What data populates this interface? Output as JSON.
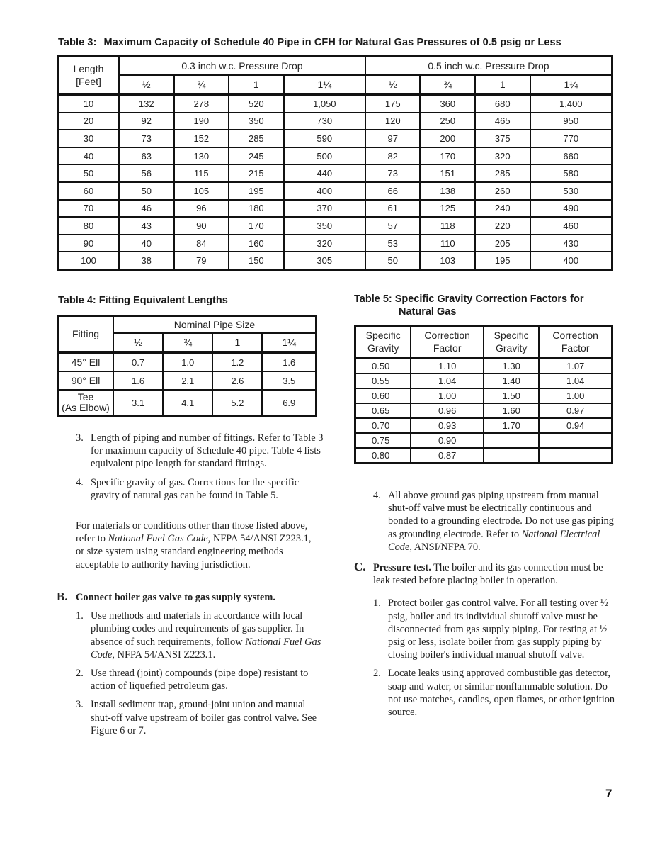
{
  "table3": {
    "label": "Table 3:",
    "title": "Maximum Capacity of Schedule 40 Pipe in CFH for Natural Gas Pressures of 0.5 psig or Less",
    "length_header_line1": "Length",
    "length_header_line2": "[Feet]",
    "group_headers": [
      "0.3 inch w.c. Pressure Drop",
      "0.5 inch w.c. Pressure Drop"
    ],
    "pipe_sizes": [
      "½",
      "¾",
      "1",
      "1¼",
      "½",
      "¾",
      "1",
      "1¼"
    ],
    "rows": [
      [
        "10",
        "132",
        "278",
        "520",
        "1,050",
        "175",
        "360",
        "680",
        "1,400"
      ],
      [
        "20",
        "92",
        "190",
        "350",
        "730",
        "120",
        "250",
        "465",
        "950"
      ],
      [
        "30",
        "73",
        "152",
        "285",
        "590",
        "97",
        "200",
        "375",
        "770"
      ],
      [
        "40",
        "63",
        "130",
        "245",
        "500",
        "82",
        "170",
        "320",
        "660"
      ],
      [
        "50",
        "56",
        "115",
        "215",
        "440",
        "73",
        "151",
        "285",
        "580"
      ],
      [
        "60",
        "50",
        "105",
        "195",
        "400",
        "66",
        "138",
        "260",
        "530"
      ],
      [
        "70",
        "46",
        "96",
        "180",
        "370",
        "61",
        "125",
        "240",
        "490"
      ],
      [
        "80",
        "43",
        "90",
        "170",
        "350",
        "57",
        "118",
        "220",
        "460"
      ],
      [
        "90",
        "40",
        "84",
        "160",
        "320",
        "53",
        "110",
        "205",
        "430"
      ],
      [
        "100",
        "38",
        "79",
        "150",
        "305",
        "50",
        "103",
        "195",
        "400"
      ]
    ]
  },
  "table4": {
    "title": "Table 4: Fitting Equivalent Lengths",
    "fitting_header": "Fitting",
    "group_header": "Nominal Pipe Size",
    "pipe_sizes": [
      "½",
      "¾",
      "1",
      "1¼"
    ],
    "rows": [
      {
        "fitting_line1": "45° Ell",
        "fitting_line2": "",
        "values": [
          "0.7",
          "1.0",
          "1.2",
          "1.6"
        ]
      },
      {
        "fitting_line1": "90° Ell",
        "fitting_line2": "",
        "values": [
          "1.6",
          "2.1",
          "2.6",
          "3.5"
        ]
      },
      {
        "fitting_line1": "Tee",
        "fitting_line2": "(As Elbow)",
        "values": [
          "3.1",
          "4.1",
          "5.2",
          "6.9"
        ]
      }
    ]
  },
  "table5": {
    "title_line1": "Table 5: Specific Gravity Correction Factors for",
    "title_line2": "Natural Gas",
    "headers": [
      {
        "line1": "Specific",
        "line2": "Gravity"
      },
      {
        "line1": "Correction",
        "line2": "Factor"
      },
      {
        "line1": "Specific",
        "line2": "Gravity"
      },
      {
        "line1": "Correction",
        "line2": "Factor"
      }
    ],
    "rows": [
      [
        "0.50",
        "1.10",
        "1.30",
        "1.07"
      ],
      [
        "0.55",
        "1.04",
        "1.40",
        "1.04"
      ],
      [
        "0.60",
        "1.00",
        "1.50",
        "1.00"
      ],
      [
        "0.65",
        "0.96",
        "1.60",
        "0.97"
      ],
      [
        "0.70",
        "0.93",
        "1.70",
        "0.94"
      ],
      [
        "0.75",
        "0.90",
        "",
        ""
      ],
      [
        "0.80",
        "0.87",
        "",
        ""
      ]
    ]
  },
  "left_list": [
    {
      "num": "3.",
      "text": "Length of piping and number of fittings. Refer to Table 3 for maximum capacity of Schedule 40 pipe. Table 4 lists equivalent pipe length for standard fittings."
    },
    {
      "num": "4.",
      "text": "Specific gravity of gas. Corrections for the specific gravity of natural gas can be found in Table 5."
    }
  ],
  "left_para": {
    "before": "For materials or conditions other than those listed above, refer to ",
    "italic": "National Fuel Gas Code",
    "after": ", NFPA 54/ANSI Z223.1, or size system using standard engineering methods acceptable to authority having jurisdiction."
  },
  "section_b": {
    "letter": "B.",
    "heading": "Connect boiler gas valve to gas supply system.",
    "items": [
      {
        "num": "1.",
        "before": "Use methods and materials in accordance with local plumbing codes and requirements of gas supplier. In absence of such requirements, follow ",
        "italic": "National Fuel Gas Code",
        "after": ", NFPA 54/ANSI Z223.1."
      },
      {
        "num": "2.",
        "before": "Use thread (joint) compounds (pipe dope) resistant to action of liquefied petroleum gas.",
        "italic": "",
        "after": ""
      },
      {
        "num": "3.",
        "before": "Install sediment trap, ground-joint union and manual shut-off valve upstream of boiler gas control valve. See Figure 6 or 7.",
        "italic": "",
        "after": ""
      }
    ]
  },
  "right_item4": {
    "num": "4.",
    "before": "All above ground gas piping upstream from manual shut-off valve must be electrically continuous and bonded to a grounding electrode.  Do not use gas piping as grounding electrode.  Refer to ",
    "italic": "National Electrical Code",
    "after": ", ANSI/NFPA 70."
  },
  "section_c": {
    "letter": "C.",
    "heading": "Pressure test.",
    "intro": " The boiler and its gas connection must be leak tested before placing boiler in operation.",
    "items": [
      {
        "num": "1.",
        "text": "Protect boiler gas control valve. For all testing over ½ psig, boiler and its individual shutoff valve must be disconnected from gas supply piping. For testing at ½ psig or less, isolate boiler from gas supply piping by closing boiler's individual manual shutoff valve."
      },
      {
        "num": "2.",
        "text": "Locate leaks using approved combustible gas detector, soap and water, or similar nonflammable solution. Do not use matches, candles, open flames, or other ignition source."
      }
    ]
  },
  "page_number": "7"
}
